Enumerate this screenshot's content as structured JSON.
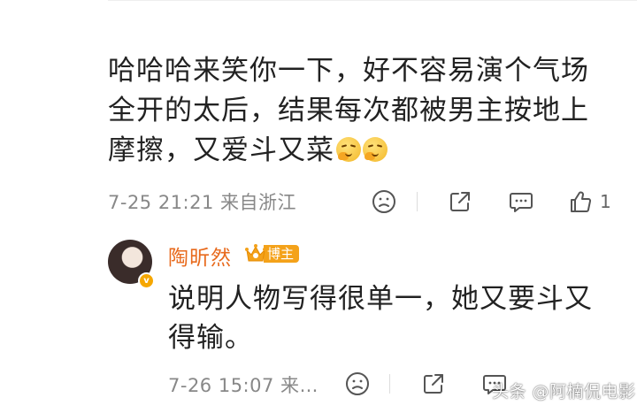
{
  "comment": {
    "text": "哈哈哈来笑你一下，好不容易演个气场全开的太后，结果每次都被男主按地上摩擦，又爱斗又菜",
    "emojis": [
      "thinking-emoji",
      "thinking-emoji"
    ],
    "time": "7-25 21:21",
    "source": "来自浙江",
    "like_count": "1"
  },
  "reply": {
    "author": "陶昕然",
    "badge_label": "博主",
    "text": "说明人物写得很单一，她又要斗又得输。",
    "time": "7-26 15:07",
    "source_truncated": "来…"
  },
  "watermark": {
    "text": "头条 @阿楠侃电影"
  },
  "colors": {
    "author_name": "#e86a1d",
    "badge": "#f4a21a",
    "meta_text": "#888888",
    "body_text": "#222222"
  }
}
